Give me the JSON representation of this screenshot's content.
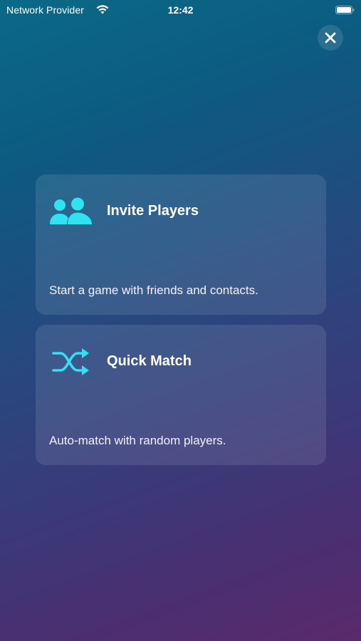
{
  "status_bar": {
    "carrier": "Network Provider",
    "time": "12:42",
    "wifi_icon": "wifi-icon",
    "battery_icon": "battery-icon"
  },
  "close_button": {
    "icon": "close-icon"
  },
  "options": [
    {
      "title": "Invite Players",
      "description": "Start a game with friends and contacts.",
      "icon": "people-icon"
    },
    {
      "title": "Quick Match",
      "description": "Auto-match with random players.",
      "icon": "shuffle-icon"
    }
  ],
  "colors": {
    "accent": "#2fe3f2",
    "card_background": "rgba(255,255,255,0.10)",
    "gradient_top": "#0a6a86",
    "gradient_bottom": "#5a2a6c"
  }
}
